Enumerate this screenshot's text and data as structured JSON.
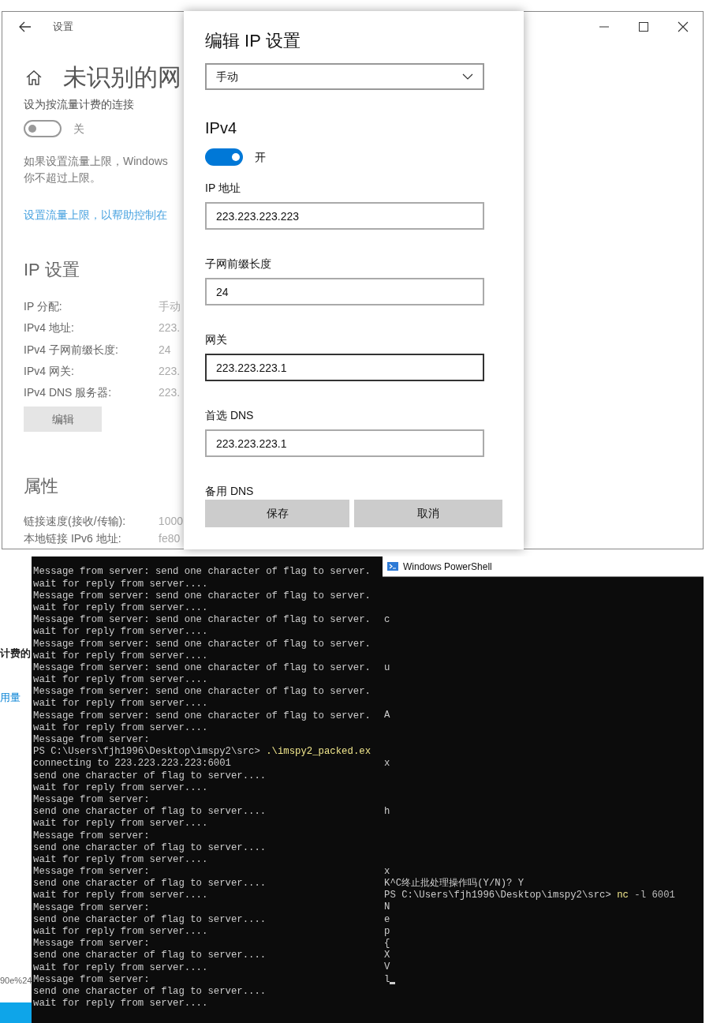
{
  "settings_window": {
    "title": "设置",
    "heading": "未识别的网",
    "metered": {
      "label": "设为按流量计费的连接",
      "toggle": {
        "on": false,
        "label": "关"
      }
    },
    "description": "如果设置流量上限，Windows\n你不超过上限。",
    "link": "设置流量上限，以帮助控制在",
    "ip_section": {
      "title": "IP 设置",
      "rows": [
        {
          "label": "IP 分配:",
          "value": "手动"
        },
        {
          "label": "IPv4 地址:",
          "value": "223."
        },
        {
          "label": "IPv4 子网前缀长度:",
          "value": "24"
        },
        {
          "label": "IPv4 网关:",
          "value": "223."
        },
        {
          "label": "IPv4 DNS 服务器:",
          "value": "223."
        }
      ],
      "edit_button": "编辑"
    },
    "properties_section": {
      "title": "属性",
      "rows": [
        {
          "label": "链接速度(接收/传输):",
          "value": "1000"
        },
        {
          "label": "本地链接 IPv6 地址:",
          "value": "fe80"
        }
      ]
    }
  },
  "edit_ip_dialog": {
    "title": "编辑 IP 设置",
    "mode": "手动",
    "section": "IPv4",
    "toggle": {
      "on": true,
      "label": "开"
    },
    "fields": [
      {
        "label": "IP 地址",
        "value": "223.223.223.223",
        "focused": false
      },
      {
        "label": "子网前缀长度",
        "value": "24",
        "focused": false
      },
      {
        "label": "网关",
        "value": "223.223.223.1",
        "focused": true
      },
      {
        "label": "首选 DNS",
        "value": "223.223.223.1",
        "focused": false
      }
    ],
    "next_label": "备用 DNS",
    "buttons": [
      "保存",
      "取消"
    ]
  },
  "background_fragments": [
    {
      "kind": "text",
      "text": "计费的"
    },
    {
      "kind": "link",
      "text": "用量"
    },
    {
      "kind": "small",
      "text": "90e%24"
    }
  ],
  "console_window": {
    "lines": [
      {
        "kind": "out",
        "text": "Message from server: send one character of flag to server."
      },
      {
        "kind": "out",
        "text": "wait for reply from server...."
      },
      {
        "kind": "out",
        "text": "Message from server: send one character of flag to server."
      },
      {
        "kind": "out",
        "text": "wait for reply from server...."
      },
      {
        "kind": "out",
        "text": "Message from server: send one character of flag to server."
      },
      {
        "kind": "out",
        "text": "wait for reply from server...."
      },
      {
        "kind": "out",
        "text": "Message from server: send one character of flag to server."
      },
      {
        "kind": "out",
        "text": "wait for reply from server...."
      },
      {
        "kind": "out",
        "text": "Message from server: send one character of flag to server."
      },
      {
        "kind": "out",
        "text": "wait for reply from server...."
      },
      {
        "kind": "out",
        "text": "Message from server: send one character of flag to server."
      },
      {
        "kind": "out",
        "text": "wait for reply from server...."
      },
      {
        "kind": "out",
        "text": "Message from server: send one character of flag to server."
      },
      {
        "kind": "out",
        "text": "wait for reply from server...."
      },
      {
        "kind": "out",
        "text": "Message from server:"
      },
      {
        "kind": "prompt",
        "prompt": "PS C:\\Users\\fjh1996\\Desktop\\imspy2\\src>",
        "command": ".\\imspy2_packed.ex"
      },
      {
        "kind": "out",
        "text": "connecting to 223.223.223.223:6001"
      },
      {
        "kind": "out",
        "text": "send one character of flag to server...."
      },
      {
        "kind": "out",
        "text": "wait for reply from server...."
      },
      {
        "kind": "out",
        "text": "Message from server:"
      },
      {
        "kind": "out",
        "text": "send one character of flag to server...."
      },
      {
        "kind": "out",
        "text": "wait for reply from server...."
      },
      {
        "kind": "out",
        "text": "Message from server:"
      },
      {
        "kind": "out",
        "text": "send one character of flag to server...."
      },
      {
        "kind": "out",
        "text": "wait for reply from server...."
      },
      {
        "kind": "out",
        "text": "Message from server:"
      },
      {
        "kind": "out",
        "text": "send one character of flag to server...."
      },
      {
        "kind": "out",
        "text": "wait for reply from server...."
      },
      {
        "kind": "out",
        "text": "Message from server:"
      },
      {
        "kind": "out",
        "text": "send one character of flag to server...."
      },
      {
        "kind": "out",
        "text": "wait for reply from server...."
      },
      {
        "kind": "out",
        "text": "Message from server:"
      },
      {
        "kind": "out",
        "text": "send one character of flag to server...."
      },
      {
        "kind": "out",
        "text": "wait for reply from server...."
      },
      {
        "kind": "out",
        "text": "Message from server:"
      },
      {
        "kind": "out",
        "text": "send one character of flag to server...."
      },
      {
        "kind": "out",
        "text": "wait for reply from server...."
      }
    ]
  },
  "powershell_window": {
    "title": "Windows PowerShell",
    "lines": [
      {
        "kind": "blank"
      },
      {
        "kind": "blank"
      },
      {
        "kind": "blank"
      },
      {
        "kind": "out",
        "text": "c"
      },
      {
        "kind": "blank"
      },
      {
        "kind": "blank"
      },
      {
        "kind": "blank"
      },
      {
        "kind": "out",
        "text": "u"
      },
      {
        "kind": "blank"
      },
      {
        "kind": "blank"
      },
      {
        "kind": "blank"
      },
      {
        "kind": "out",
        "text": "A"
      },
      {
        "kind": "blank"
      },
      {
        "kind": "blank"
      },
      {
        "kind": "blank"
      },
      {
        "kind": "out",
        "text": "x"
      },
      {
        "kind": "blank"
      },
      {
        "kind": "blank"
      },
      {
        "kind": "blank"
      },
      {
        "kind": "out",
        "text": "h"
      },
      {
        "kind": "blank"
      },
      {
        "kind": "blank"
      },
      {
        "kind": "blank"
      },
      {
        "kind": "blank"
      },
      {
        "kind": "out",
        "text": "x"
      },
      {
        "kind": "out",
        "text": "K^C终止批处理操作吗(Y/N)? Y"
      },
      {
        "kind": "prompt",
        "prompt": "PS C:\\Users\\fjh1996\\Desktop\\imspy2\\src>",
        "command": "nc",
        "args": "-l 6001"
      },
      {
        "kind": "out",
        "text": "N"
      },
      {
        "kind": "out",
        "text": "e"
      },
      {
        "kind": "out",
        "text": "p"
      },
      {
        "kind": "out",
        "text": "{"
      },
      {
        "kind": "out",
        "text": "X"
      },
      {
        "kind": "out",
        "text": "V"
      },
      {
        "kind": "cursor",
        "text": "l"
      }
    ]
  }
}
